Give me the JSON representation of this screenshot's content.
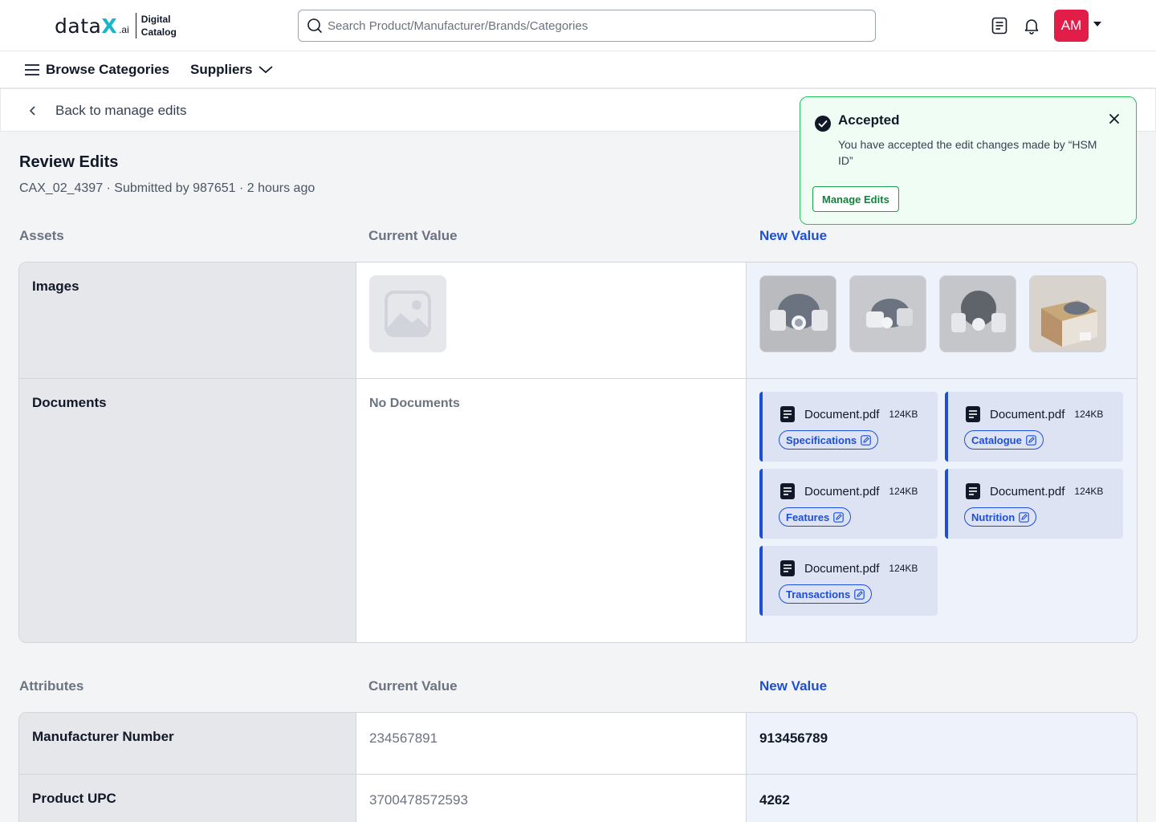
{
  "header": {
    "logo_word_data": "data",
    "logo_word_x": "X",
    "logo_ai": ".ai",
    "logo_sub_line1": "Digital",
    "logo_sub_line2": "Catalog",
    "search_placeholder": "Search Product/Manufacturer/Brands/Categories",
    "avatar_initials": "AM",
    "accent_color": "#e11d48"
  },
  "nav": {
    "browse_label": "Browse Categories",
    "suppliers_label": "Suppliers"
  },
  "back": {
    "label": "Back to manage edits"
  },
  "page": {
    "title": "Review Edits",
    "subtitle": "CAX_02_4397 · Submitted by 987651 · 2 hours ago"
  },
  "assets": {
    "heading": "Assets",
    "current_heading": "Current Value",
    "new_heading": "New Value",
    "images_label": "Images",
    "documents_label": "Documents",
    "no_documents": "No Documents",
    "documents": [
      {
        "name": "Document.pdf",
        "size": "124KB",
        "tag": "Specifications"
      },
      {
        "name": "Document.pdf",
        "size": "124KB",
        "tag": "Catalogue"
      },
      {
        "name": "Document.pdf",
        "size": "124KB",
        "tag": "Features"
      },
      {
        "name": "Document.pdf",
        "size": "124KB",
        "tag": "Nutrition"
      },
      {
        "name": "Document.pdf",
        "size": "124KB",
        "tag": "Transactions"
      }
    ]
  },
  "attributes": {
    "heading": "Attributes",
    "current_heading": "Current Value",
    "new_heading": "New Value",
    "rows": [
      {
        "label": "Manufacturer Number",
        "current": "234567891",
        "new": "913456789"
      },
      {
        "label": "Product UPC",
        "current": "3700478572593",
        "new": "4262"
      }
    ]
  },
  "toast": {
    "title": "Accepted",
    "message": "You have accepted the edit changes made by “HSM ID”",
    "button": "Manage Edits",
    "color": "#22c55e"
  }
}
